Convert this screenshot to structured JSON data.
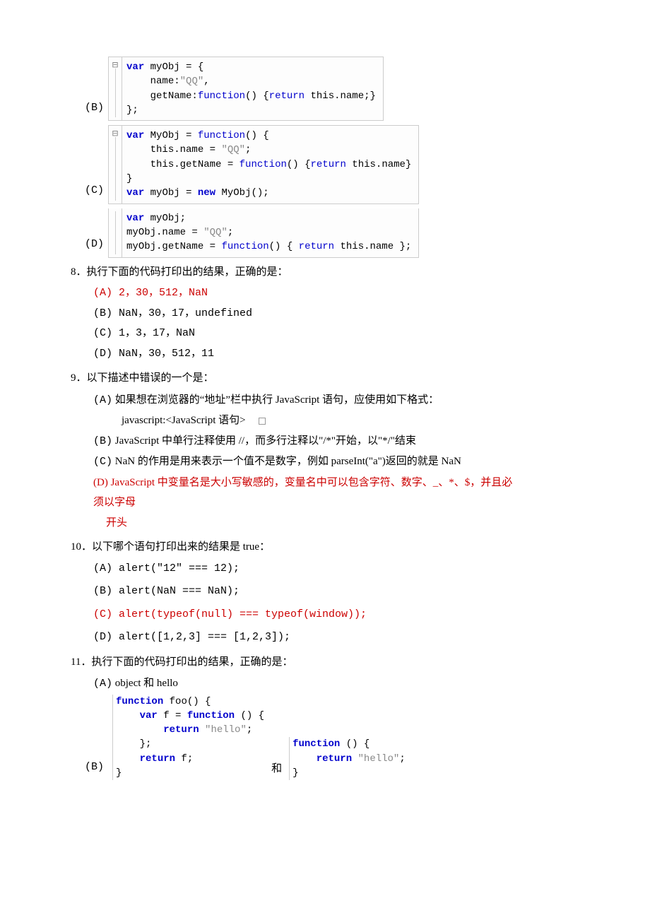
{
  "codeB": {
    "label": "(B)",
    "l1a": "var",
    "l1b": " myObj = {",
    "l2": "    name:",
    "l2s": "\"QQ\"",
    "l2c": ",",
    "l3a": "    getName:",
    "l3b": "function",
    "l3c": "() {",
    "l3d": "return",
    "l3e": " this.name;}",
    "l4": "};"
  },
  "codeC": {
    "label": "(C)",
    "l1a": "var",
    "l1b": " MyObj = ",
    "l1c": "function",
    "l1d": "() {",
    "l2a": "    this.name = ",
    "l2s": "\"QQ\"",
    "l2c": ";",
    "l3a": "    this.getName = ",
    "l3b": "function",
    "l3c": "() {",
    "l3d": "return",
    "l3e": " this.name}",
    "l4": "}",
    "l5a": "var",
    "l5b": " myObj = ",
    "l5c": "new",
    "l5d": " MyObj();"
  },
  "codeD": {
    "label": "(D)",
    "l1a": "var",
    "l1b": " myObj;",
    "l2a": "myObj.name = ",
    "l2s": "\"QQ\"",
    "l2c": ";",
    "l3a": "myObj.getName = ",
    "l3b": "function",
    "l3c": "() { ",
    "l3d": "return",
    "l3e": " this.name };"
  },
  "q8": {
    "title": "8．执行下面的代码打印出的结果，正确的是：",
    "a": "(A) 2，30，512，NaN",
    "b": "(B) NaN，30，17，undefined",
    "c": "(C) 1，3，17，NaN",
    "d": "(D) NaN，30，512，11"
  },
  "q9": {
    "title": "9．以下描述中错误的一个是：",
    "a": "(A) 如果想在浏览器的\"地址\"栏中执行 JavaScript 语句，应使用如下格式：",
    "a2": "javascript:<JavaScript 语句>",
    "b": "(B) JavaScript 中单行注释使用 //，而多行注释以\"/*\"开始，以\"*/\"结束",
    "c": "(C) NaN 的作用是用来表示一个值不是数字，例如 parseInt(\"a\")返回的就是 NaN",
    "d1": "(D) JavaScript 中变量名是大小写敏感的，变量名中可以包含字符、数字、_、*、$，并且必",
    "d2": "须以字母",
    "d3": "开头"
  },
  "q10": {
    "title": "10．以下哪个语句打印出来的结果是 true：",
    "a": "(A) alert(\"12\" === 12);",
    "b": "(B) alert(NaN === NaN);",
    "c": "(C) alert(typeof(null) === typeof(window));",
    "d": "(D) alert([1,2,3] === [1,2,3]);"
  },
  "q11": {
    "title": "11．执行下面的代码打印出的结果，正确的是：",
    "a": "(A) object 和 hello",
    "b_label": "(B)",
    "and": "和",
    "left": {
      "l1a": "function",
      "l1b": " foo() {",
      "l2a": "    var",
      "l2b": " f = ",
      "l2c": "function",
      "l2d": " () {",
      "l3a": "        return",
      "l3s": " \"hello\"",
      "l3c": ";",
      "l4": "    };",
      "l5a": "    return",
      "l5b": " f;",
      "l6": "}"
    },
    "right": {
      "l1a": "function",
      "l1b": " () {",
      "l2a": "    return",
      "l2s": " \"hello\"",
      "l2c": ";",
      "l3": "}"
    }
  },
  "chart_data": null
}
